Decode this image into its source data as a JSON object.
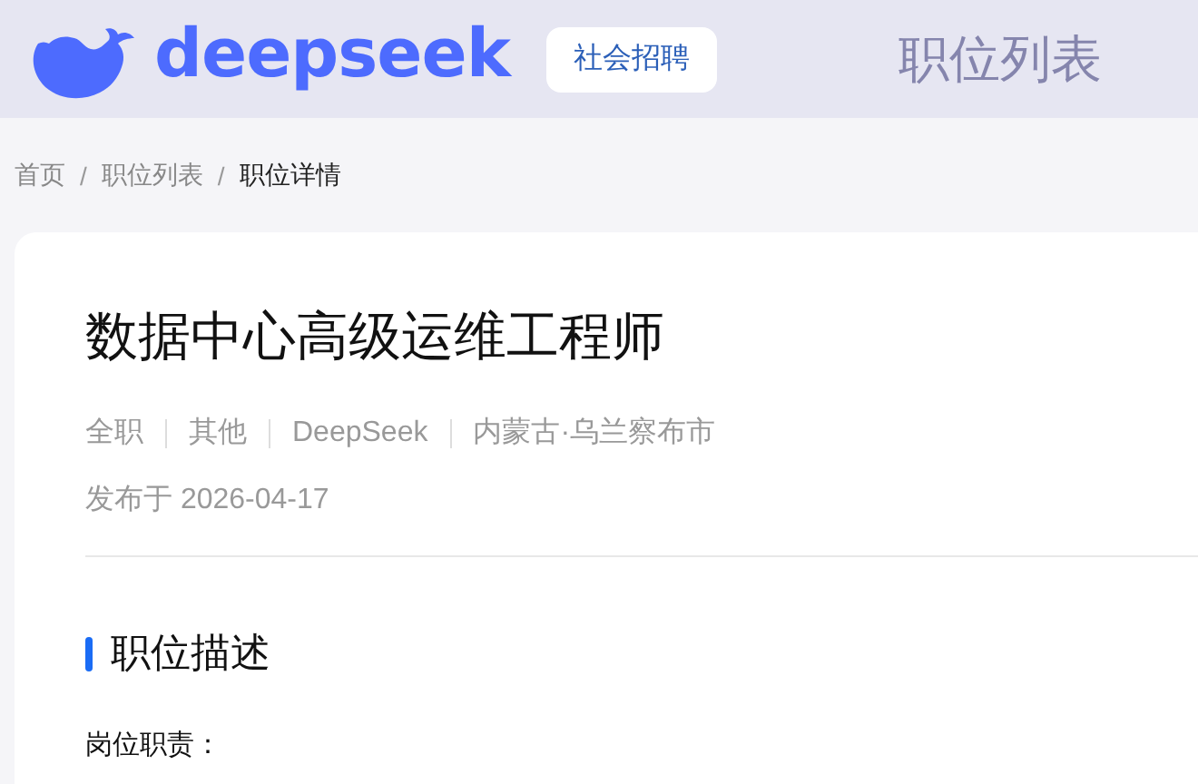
{
  "header": {
    "logo_text": "deepseek",
    "recruit_button": "社会招聘",
    "nav_link": "职位列表"
  },
  "breadcrumb": [
    {
      "label": "首页",
      "selected": false
    },
    {
      "label": "职位列表",
      "selected": false
    },
    {
      "label": "职位详情",
      "selected": true
    }
  ],
  "breadcrumb_separator": "/",
  "job": {
    "title": "数据中心高级运维工程师",
    "meta": [
      "全职",
      "其他",
      "DeepSeek",
      "内蒙古·乌兰察布市"
    ],
    "published": "发布于 2026-04-17",
    "section_title": "职位描述",
    "subheading": "岗位职责："
  }
}
